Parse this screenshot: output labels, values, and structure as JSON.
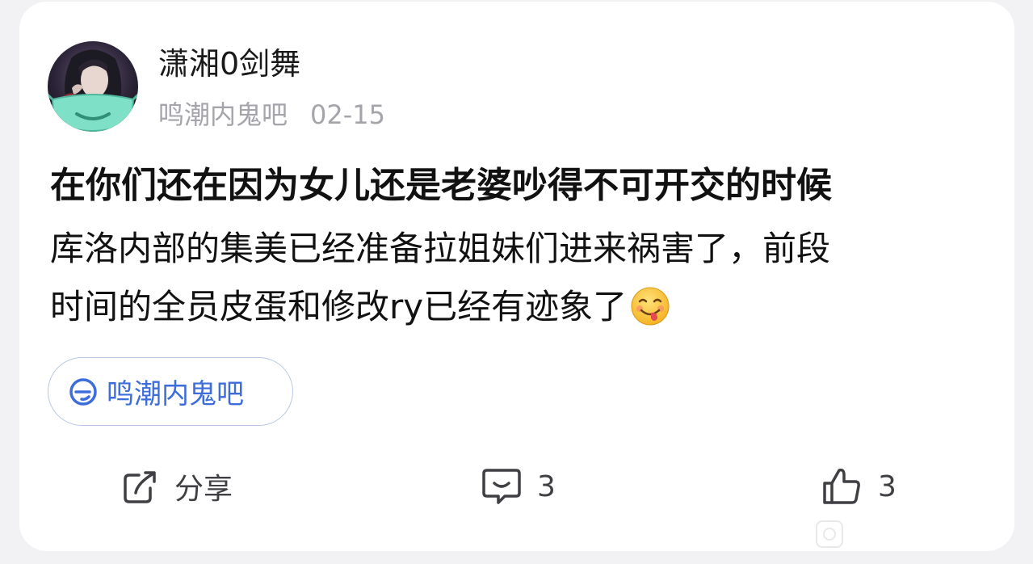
{
  "post": {
    "username": "潇湘0剑舞",
    "forum": "鸣潮内鬼吧",
    "date": "02-15",
    "title": "在你们还在因为女儿还是老婆吵得不可开交的时候",
    "body_lines": [
      "库洛内部的集美已经准备拉姐妹们进来祸害了，前段",
      "时间的全员皮蛋和修改ry已经有迹象了"
    ],
    "emoji": "yum-face-emoji"
  },
  "forum_chip": {
    "label": "鸣潮内鬼吧",
    "icon": "forum-e-icon",
    "color": "#3d6ddb"
  },
  "actions": {
    "share_label": "分享",
    "comment_count": "3",
    "like_count": "3"
  },
  "icons": {
    "share": "share-icon",
    "comment": "comment-icon",
    "like": "thumbs-up-icon"
  }
}
